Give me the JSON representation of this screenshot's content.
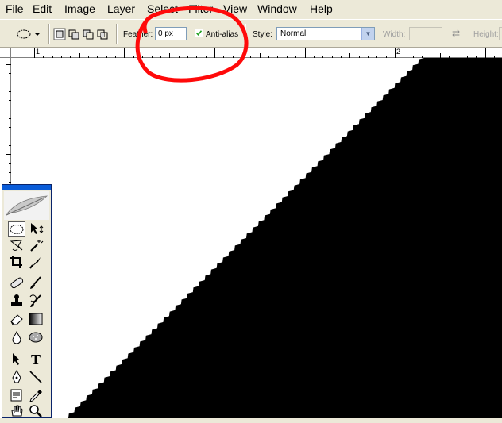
{
  "menu": [
    "File",
    "Edit",
    "Image",
    "Layer",
    "Select",
    "Filter",
    "View",
    "Window",
    "Help"
  ],
  "options": {
    "feather_label": "Feather:",
    "feather_value": "0 px",
    "antialias_label": "Anti-alias",
    "antialias_checked": true,
    "style_label": "Style:",
    "style_value": "Normal",
    "width_label": "Width:",
    "height_label": "Height:"
  },
  "ruler": {
    "top_numbers": [
      "1",
      "2"
    ]
  },
  "toolbox": {
    "tools": [
      "elliptical-marquee-tool",
      "move-tool",
      "lasso-tool",
      "magic-wand-tool",
      "crop-tool",
      "slice-tool",
      "healing-brush-tool",
      "brush-tool",
      "clone-stamp-tool",
      "history-brush-tool",
      "eraser-tool",
      "gradient-tool",
      "blur-tool",
      "dodge-tool",
      "path-selection-tool",
      "type-tool",
      "pen-tool",
      "line-tool",
      "notes-tool",
      "eyedropper-tool",
      "hand-tool",
      "zoom-tool"
    ],
    "type_glyph": "T"
  },
  "colors": {
    "accent": "#0a5cd8",
    "annotation": "#ff0000",
    "canvas_fill": "#000000"
  }
}
